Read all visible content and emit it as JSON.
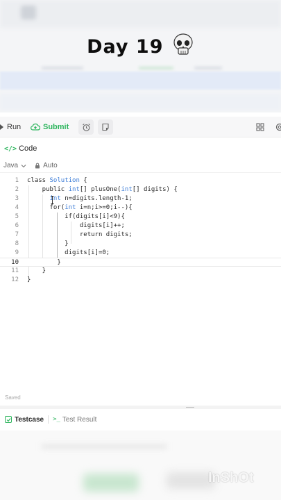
{
  "overlay": {
    "title": "Day 19",
    "emoji_icon": "skull-icon"
  },
  "toolbar": {
    "run_label": "Run",
    "submit_label": "Submit"
  },
  "code_panel": {
    "title": "Code",
    "language": "Java",
    "mode": "Auto"
  },
  "editor": {
    "active_line": 10,
    "lines": [
      {
        "n": "1",
        "text": "class Solution {"
      },
      {
        "n": "2",
        "text": "    public int[] plusOne(int[] digits) {"
      },
      {
        "n": "3",
        "text": "      int n=digits.length-1;"
      },
      {
        "n": "4",
        "text": "      for(int i=n;i>=0;i--){"
      },
      {
        "n": "5",
        "text": "          if(digits[i]<9){"
      },
      {
        "n": "6",
        "text": "              digits[i]++;"
      },
      {
        "n": "7",
        "text": "              return digits;"
      },
      {
        "n": "8",
        "text": "          }"
      },
      {
        "n": "9",
        "text": "          digits[i]=0;"
      },
      {
        "n": "10",
        "text": "        }"
      },
      {
        "n": "11",
        "text": "    }"
      },
      {
        "n": "12",
        "text": "}"
      }
    ]
  },
  "status": {
    "saved": "Saved"
  },
  "bottom_tabs": {
    "testcase": "Testcase",
    "test_result": "Test Result"
  },
  "watermark": "InShOt",
  "colors": {
    "accent_green": "#2db55d",
    "keyword_blue": "#3b7bd6"
  }
}
